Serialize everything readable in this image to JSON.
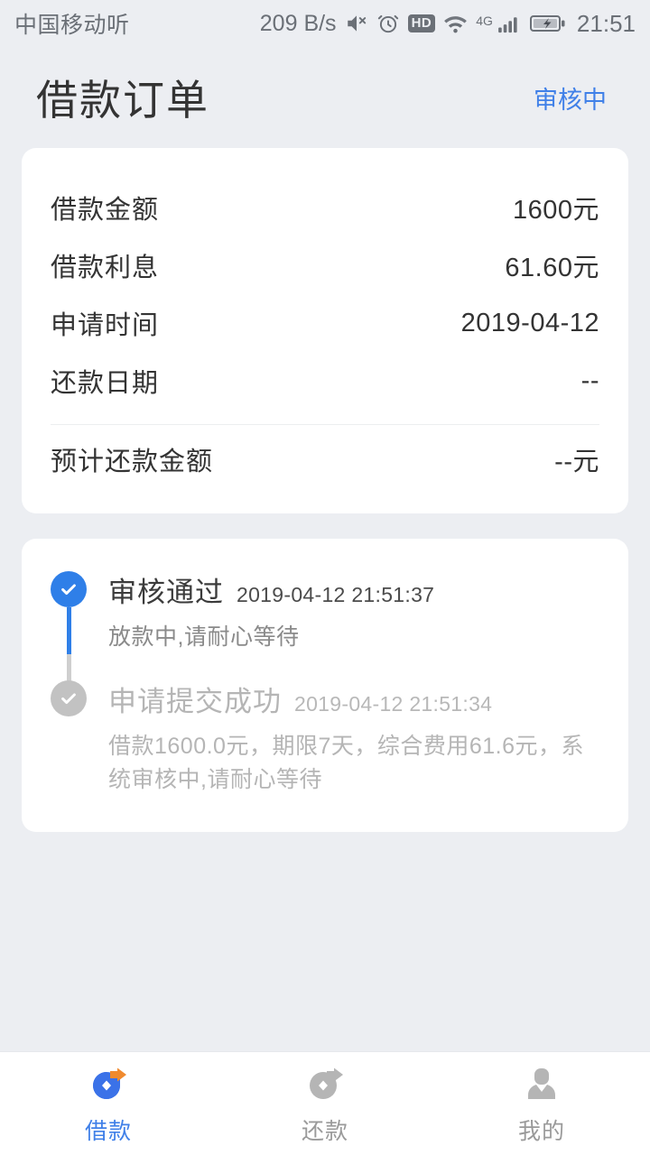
{
  "statusbar": {
    "carrier": "中国移动听",
    "netspeed": "209 B/s",
    "hd_label": "HD",
    "network_label": "4G",
    "clock": "21:51",
    "icons": [
      "mute-icon",
      "alarm-icon",
      "hd-icon",
      "wifi-icon",
      "signal-icon",
      "battery-charging-icon"
    ]
  },
  "header": {
    "title": "借款订单",
    "status": "审核中",
    "status_color": "#4080e8"
  },
  "detail": {
    "rows": [
      {
        "label": "借款金额",
        "value": "1600元"
      },
      {
        "label": "借款利息",
        "value": "61.60元"
      },
      {
        "label": "申请时间",
        "value": "2019-04-12"
      },
      {
        "label": "还款日期",
        "value": "--"
      }
    ],
    "summary": {
      "label": "预计还款金额",
      "value": "--元"
    }
  },
  "timeline": {
    "steps": [
      {
        "title": "审核通过",
        "time": "2019-04-12 21:51:37",
        "desc": "放款中,请耐心等待",
        "state": "done"
      },
      {
        "title": "申请提交成功",
        "time": "2019-04-12 21:51:34",
        "desc": "借款1600.0元，期限7天，综合费用61.6元，系统审核中,请耐心等待",
        "state": "muted"
      }
    ]
  },
  "bottomnav": {
    "items": [
      {
        "label": "借款",
        "icon": "coin-arrow-icon",
        "active": true
      },
      {
        "label": "还款",
        "icon": "coin-return-icon",
        "active": false
      },
      {
        "label": "我的",
        "icon": "person-icon",
        "active": false
      }
    ],
    "active_color": "#4080e8",
    "inactive_color": "#b0b0b0"
  }
}
